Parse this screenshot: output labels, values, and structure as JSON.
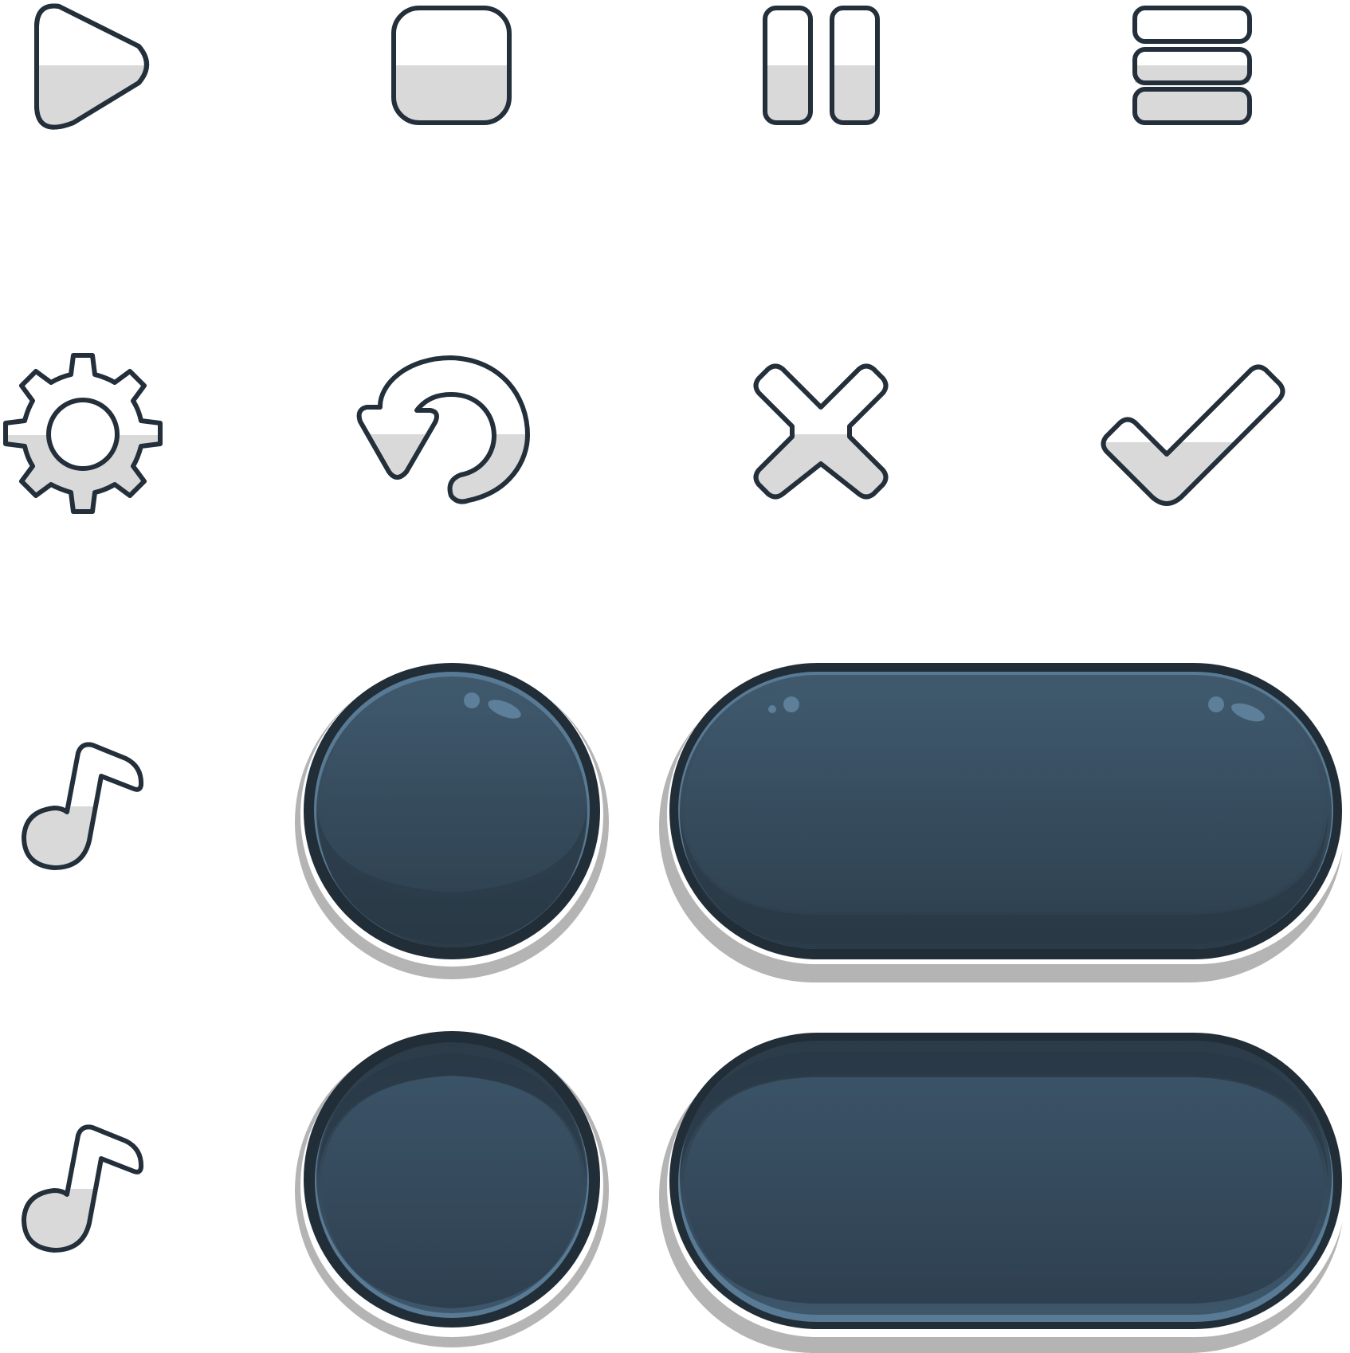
{
  "sheet": {
    "background": "#ffffff",
    "outline_color": "#232f3a",
    "icon_fill_color": "#d9d9d9",
    "icon_highlight_color": "#ffffff",
    "button_colors": {
      "rim": "#212d37",
      "face_top": "#3e586c",
      "face_bottom": "#2b3c4a",
      "glow": "#587a94",
      "shadow": "#b4b4b4",
      "shine": "#5d7f99"
    }
  },
  "icons": [
    {
      "name": "play-icon",
      "label": ""
    },
    {
      "name": "stop-icon",
      "label": ""
    },
    {
      "name": "pause-icon",
      "label": ""
    },
    {
      "name": "menu-icon",
      "label": ""
    },
    {
      "name": "gear-icon",
      "label": ""
    },
    {
      "name": "restart-icon",
      "label": ""
    },
    {
      "name": "close-icon",
      "label": ""
    },
    {
      "name": "check-icon",
      "label": ""
    },
    {
      "name": "music-note-icon",
      "label": ""
    },
    {
      "name": "music-note-icon",
      "label": ""
    }
  ],
  "buttons": [
    {
      "name": "round-button-normal",
      "state": "normal",
      "shape": "circle"
    },
    {
      "name": "pill-button-normal",
      "state": "normal",
      "shape": "pill"
    },
    {
      "name": "round-button-pressed",
      "state": "pressed",
      "shape": "circle"
    },
    {
      "name": "pill-button-pressed",
      "state": "pressed",
      "shape": "pill"
    }
  ]
}
